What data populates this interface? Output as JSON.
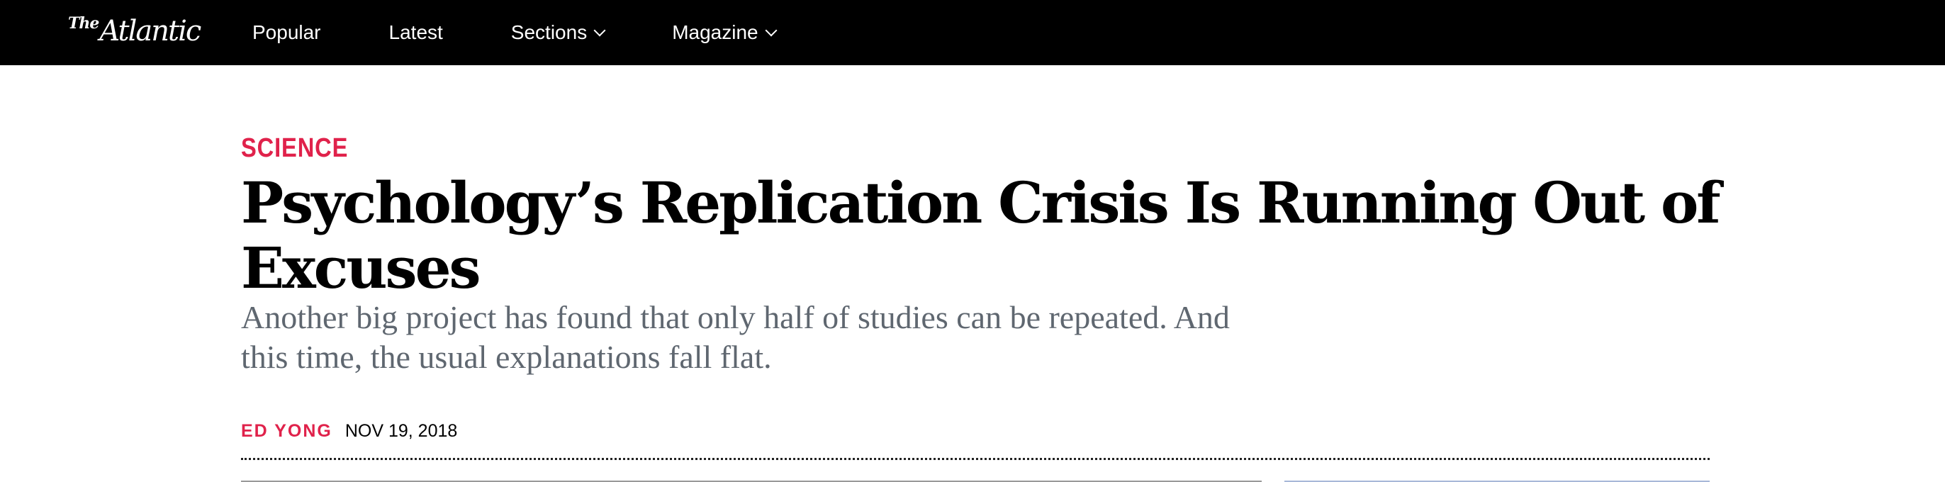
{
  "header": {
    "logo_prefix": "The",
    "logo_name": "Atlantic",
    "nav": [
      {
        "label": "Popular",
        "has_dropdown": false
      },
      {
        "label": "Latest",
        "has_dropdown": false
      },
      {
        "label": "Sections",
        "has_dropdown": true
      },
      {
        "label": "Magazine",
        "has_dropdown": true
      }
    ]
  },
  "article": {
    "section": "SCIENCE",
    "headline": "Psychology’s Replication Crisis Is Running Out of Excuses",
    "dek": "Another big project has found that only half of studies can be repeated. And this time, the usual explanations fall flat.",
    "author": "ED YONG",
    "date": "NOV 19, 2018"
  },
  "colors": {
    "accent": "#e0224b",
    "topbar_bg": "#000000",
    "dek_text": "#5f6770"
  }
}
